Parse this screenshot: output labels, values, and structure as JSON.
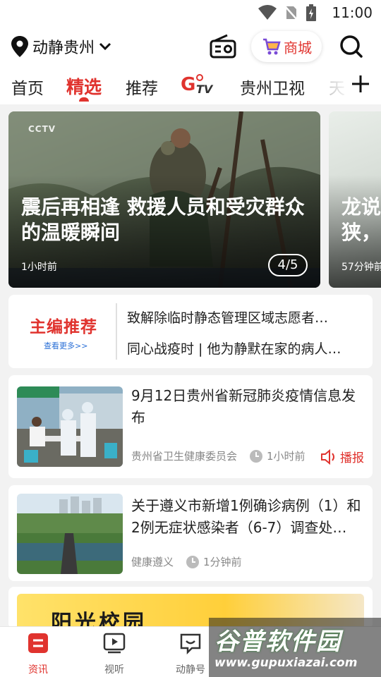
{
  "status_bar": {
    "time": "11:00",
    "icons": [
      "wifi-icon",
      "no-sim-icon",
      "battery-charging-icon"
    ]
  },
  "header": {
    "location": "动静贵州",
    "mall_label": "商城"
  },
  "tabs": [
    {
      "label": "首页",
      "active": false
    },
    {
      "label": "精选",
      "active": true
    },
    {
      "label": "推荐",
      "active": false
    },
    {
      "label": "G TV",
      "active": false
    },
    {
      "label": "贵州卫视",
      "active": false
    },
    {
      "label": "天",
      "active": false
    }
  ],
  "carousel": {
    "slides": [
      {
        "title": "震后再相逢 救援人员和受灾群众的温暖瞬间",
        "time": "1小时前",
        "logo": "CCTV"
      },
      {
        "title": "龙说",
        "title2": "狭，",
        "time": "57分钟前"
      }
    ],
    "current": "4",
    "total": "5"
  },
  "editor_pick": {
    "logo_main": "主编",
    "logo_accent": "推荐",
    "see_more": "查看更多>>",
    "lines": [
      "致解除临时静态管理区域志愿者…",
      "同心战疫时 | 他为静默在家的病人…"
    ]
  },
  "news": [
    {
      "title": "9月12日贵州省新冠肺炎疫情信息发布",
      "source": "贵州省卫生健康委员会",
      "time": "1小时前",
      "action": "播报"
    },
    {
      "title": "关于遵义市新增1例确诊病例（1）和2例无症状感染者（6-7）调查处…",
      "source": "健康遵义",
      "time": "1分钟前"
    }
  ],
  "banner": {
    "text": "阳光校园"
  },
  "bottom_nav": [
    {
      "label": "资讯",
      "active": true
    },
    {
      "label": "视听",
      "active": false
    },
    {
      "label": "动静号",
      "active": false
    }
  ],
  "watermark": {
    "main": "谷普软件园",
    "sub": "www.gupuxiazai.com"
  },
  "colors": {
    "accent": "#e0332e",
    "editor_blue": "#2a6fd6"
  }
}
